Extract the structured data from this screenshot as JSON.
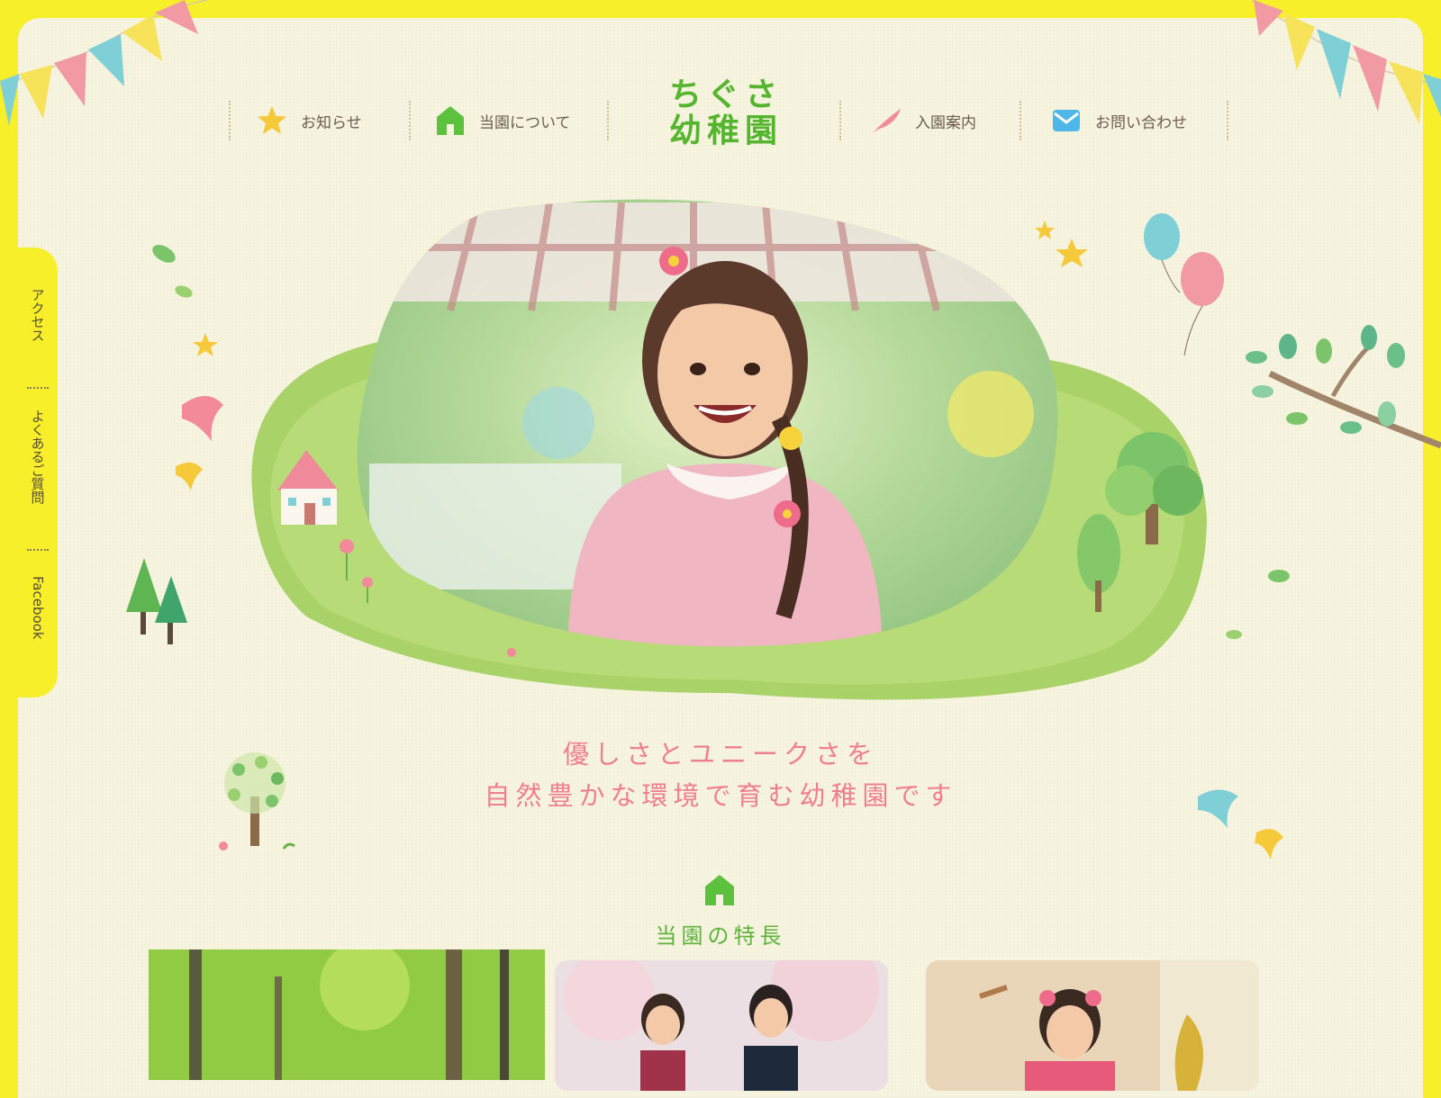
{
  "logo": {
    "line1": "ちぐさ",
    "line2": "幼稚園"
  },
  "nav": [
    {
      "label": "お知らせ",
      "icon": "star-icon"
    },
    {
      "label": "当園について",
      "icon": "house-icon"
    },
    {
      "label": "入園案内",
      "icon": "feather-icon"
    },
    {
      "label": "お問い合わせ",
      "icon": "mail-icon"
    }
  ],
  "side": {
    "access": "アクセス",
    "faq": "よくあるご質問",
    "facebook": "Facebook"
  },
  "hero": {
    "photo": "smiling-girl-photo"
  },
  "tagline": {
    "line1": "優しさとユニークさを",
    "line2": "自然豊かな環境で育む幼稚園です"
  },
  "features": {
    "title": "当園の特長",
    "cards": [
      {
        "photo": "forest-photo"
      },
      {
        "photo": "school-children-photo"
      },
      {
        "photo": "dancing-girl-photo"
      }
    ]
  },
  "colors": {
    "yellow": "#f6ef2a",
    "green": "#55b52f",
    "pink": "#ef7f8f",
    "paper": "#f6f3de"
  }
}
